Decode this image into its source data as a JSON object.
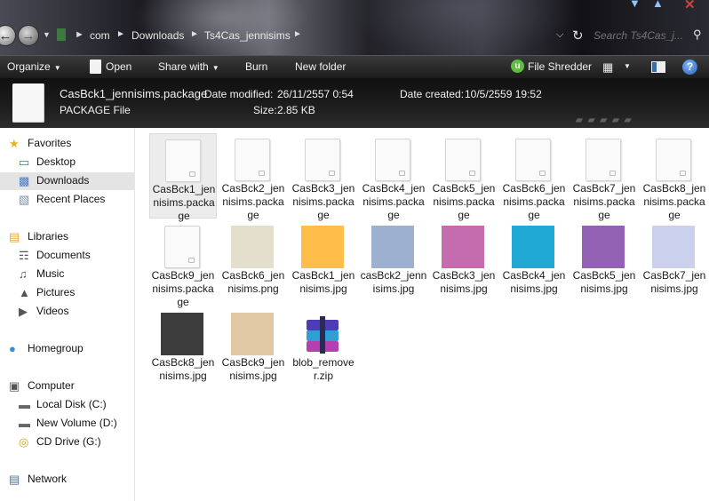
{
  "window": {
    "controls": [
      "minimize",
      "maximize",
      "close"
    ]
  },
  "address_bar": {
    "breadcrumb": [
      "com",
      "Downloads",
      "Ts4Cas_jennisims"
    ],
    "search_placeholder": "Search Ts4Cas_j..."
  },
  "toolbar": {
    "organize": "Organize",
    "open": "Open",
    "share_with": "Share with",
    "burn": "Burn",
    "new_folder": "New folder",
    "file_shredder": "File Shredder"
  },
  "details": {
    "file_name": "CasBck1_jennisims.package",
    "file_type": "PACKAGE File",
    "date_modified_label": "Date modified:",
    "date_modified": "26/11/2557 0:54",
    "date_created_label": "Date created:",
    "date_created": "10/5/2559 19:52",
    "size_label": "Size:",
    "size": "2.85 KB"
  },
  "sidebar": {
    "favorites": "Favorites",
    "favorites_items": [
      "Desktop",
      "Downloads",
      "Recent Places"
    ],
    "libraries": "Libraries",
    "libraries_items": [
      "Documents",
      "Music",
      "Pictures",
      "Videos"
    ],
    "homegroup": "Homegroup",
    "computer": "Computer",
    "computer_items": [
      "Local Disk (C:)",
      "New Volume (D:)",
      "CD Drive (G:)"
    ],
    "network": "Network",
    "selected": "Downloads"
  },
  "files": [
    {
      "name": "CasBck1_jennisims.package",
      "kind": "package",
      "selected": true
    },
    {
      "name": "CasBck2_jennisims.package",
      "kind": "package"
    },
    {
      "name": "CasBck3_jennisims.package",
      "kind": "package"
    },
    {
      "name": "CasBck4_jennisims.package",
      "kind": "package"
    },
    {
      "name": "CasBck5_jennisims.package",
      "kind": "package"
    },
    {
      "name": "CasBck6_jennisims.package",
      "kind": "package"
    },
    {
      "name": "CasBck7_jennisims.package",
      "kind": "package"
    },
    {
      "name": "CasBck8_jennisims.package",
      "kind": "package"
    },
    {
      "name": "CasBck9_jennisims.package",
      "kind": "package"
    },
    {
      "name": "CasBck6_jennisims.png",
      "kind": "image",
      "color": "#e4dfcc"
    },
    {
      "name": "CasBck1_jennisims.jpg",
      "kind": "image",
      "color": "#ffbd4a"
    },
    {
      "name": "casBck2_jennisims.jpg",
      "kind": "image",
      "color": "#9eb0d0"
    },
    {
      "name": "CasBck3_jennisims.jpg",
      "kind": "image",
      "color": "#c46cae"
    },
    {
      "name": "CasBck4_jennisims.jpg",
      "kind": "image",
      "color": "#21a9d5"
    },
    {
      "name": "CasBck5_jennisims.jpg",
      "kind": "image",
      "color": "#9362b5"
    },
    {
      "name": "CasBck7_jennisims.jpg",
      "kind": "image",
      "color": "#cbd0ec"
    },
    {
      "name": "CasBck8_jennisims.jpg",
      "kind": "image",
      "color": "#3c3c3c"
    },
    {
      "name": "CasBck9_jennisims.jpg",
      "kind": "image",
      "color": "#e0c9a3"
    },
    {
      "name": "blob_remover.zip",
      "kind": "zip"
    }
  ],
  "colors": {
    "selection": "#ececec",
    "sidebar_selected": "#e4e4e4",
    "toolbar_text": "#f2f2f2"
  }
}
